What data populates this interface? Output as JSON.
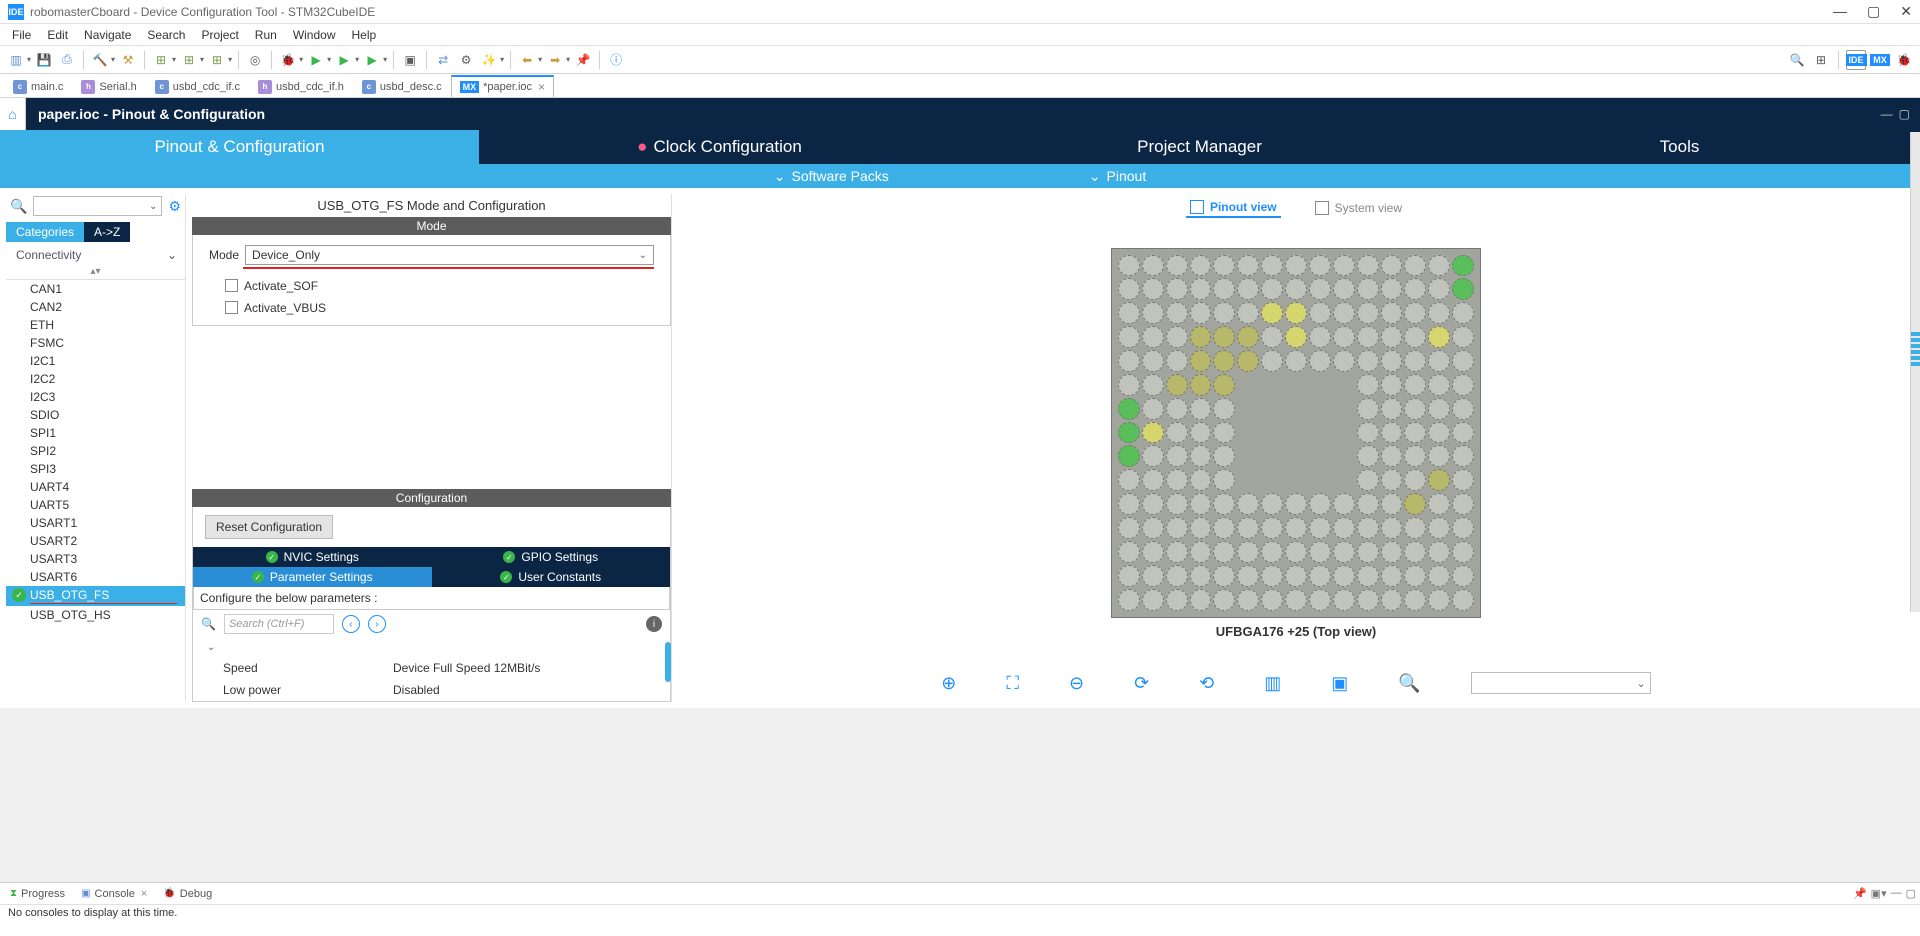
{
  "window": {
    "title": "robomasterCboard - Device Configuration Tool - STM32CubeIDE",
    "ide_badge": "IDE"
  },
  "menu": [
    "File",
    "Edit",
    "Navigate",
    "Search",
    "Project",
    "Run",
    "Window",
    "Help"
  ],
  "editor_tabs": [
    {
      "icon": "c",
      "label": "main.c"
    },
    {
      "icon": "h",
      "label": "Serial.h"
    },
    {
      "icon": "c",
      "label": "usbd_cdc_if.c"
    },
    {
      "icon": "h",
      "label": "usbd_cdc_if.h"
    },
    {
      "icon": "c",
      "label": "usbd_desc.c"
    },
    {
      "icon": "mx",
      "label": "*paper.ioc",
      "active": true
    }
  ],
  "breadcrumb": "paper.ioc - Pinout & Configuration",
  "mx_tabs": [
    "Pinout & Configuration",
    "Clock Configuration",
    "Project Manager",
    "Tools"
  ],
  "mx_tabs_active": 0,
  "mx_subtabs": {
    "software_packs": "Software Packs",
    "pinout": "Pinout"
  },
  "sidebar": {
    "cat_tab": "Categories",
    "az_tab": "A->Z",
    "group": "Connectivity",
    "items": [
      "CAN1",
      "CAN2",
      "ETH",
      "FSMC",
      "I2C1",
      "I2C2",
      "I2C3",
      "SDIO",
      "SPI1",
      "SPI2",
      "SPI3",
      "UART4",
      "UART5",
      "USART1",
      "USART2",
      "USART3",
      "USART6",
      "USB_OTG_FS",
      "USB_OTG_HS"
    ],
    "selected": "USB_OTG_FS"
  },
  "config": {
    "title": "USB_OTG_FS Mode and Configuration",
    "mode_header": "Mode",
    "mode_label": "Mode",
    "mode_value": "Device_Only",
    "activate_sof": "Activate_SOF",
    "activate_vbus": "Activate_VBUS",
    "config_header": "Configuration",
    "reset_btn": "Reset Configuration",
    "tab_nvic": "NVIC Settings",
    "tab_gpio": "GPIO Settings",
    "tab_param": "Parameter Settings",
    "tab_user": "User Constants",
    "params_hint": "Configure the below parameters :",
    "params_search_placeholder": "Search (Ctrl+F)",
    "params": [
      {
        "key": "Speed",
        "val": "Device Full Speed 12MBit/s"
      },
      {
        "key": "Low power",
        "val": "Disabled"
      }
    ]
  },
  "pinout": {
    "pinout_view": "Pinout view",
    "system_view": "System view",
    "chip_label": "UFBGA176 +25 (Top view)"
  },
  "console": {
    "progress_tab": "Progress",
    "console_tab": "Console",
    "debug_tab": "Debug",
    "message": "No consoles to display at this time."
  }
}
